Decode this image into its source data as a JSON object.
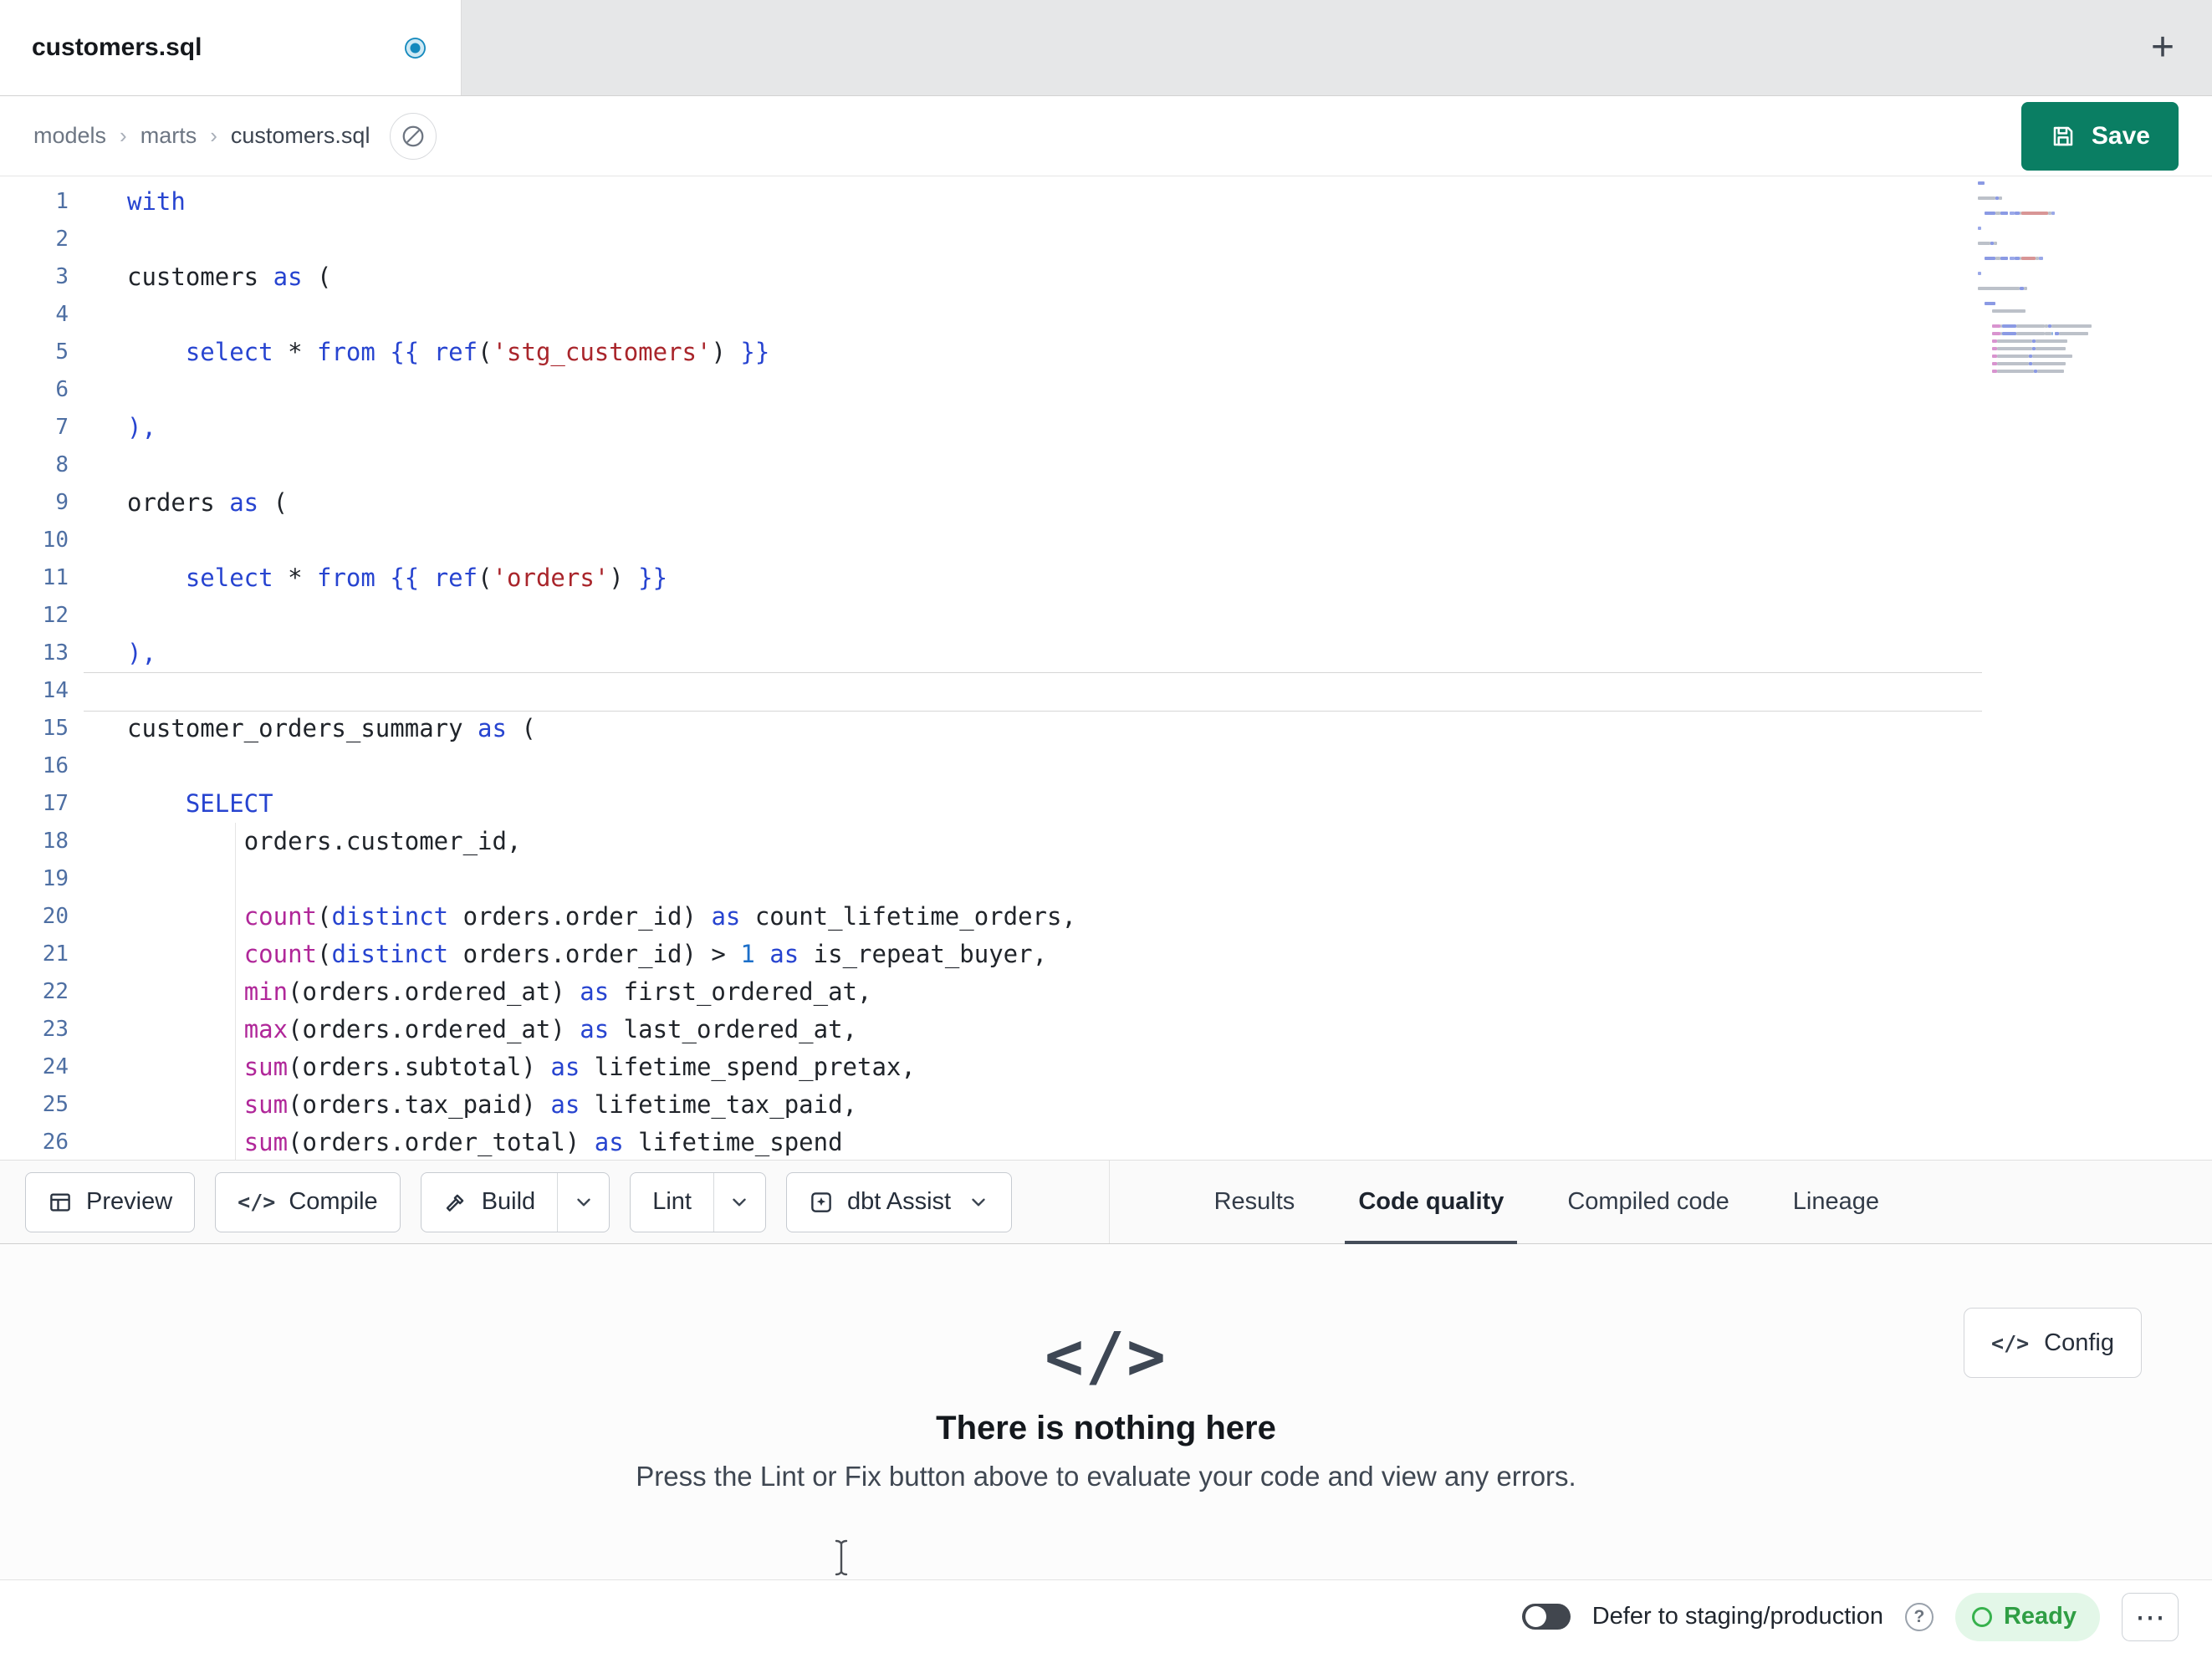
{
  "tabbar": {
    "tab_title": "customers.sql"
  },
  "breadcrumb": {
    "items": [
      "models",
      "marts",
      "customers.sql"
    ],
    "separator": "›"
  },
  "save_button": {
    "label": "Save"
  },
  "icons": {
    "plus": "+",
    "help": "?",
    "more": "⋯",
    "code_glyph": "</>"
  },
  "toolbar": {
    "preview": "Preview",
    "compile": "Compile",
    "build": "Build",
    "lint": "Lint",
    "assist": "dbt Assist"
  },
  "panel_tabs": [
    {
      "label": "Results",
      "active": false
    },
    {
      "label": "Code quality",
      "active": true
    },
    {
      "label": "Compiled code",
      "active": false
    },
    {
      "label": "Lineage",
      "active": false
    }
  ],
  "results_panel": {
    "empty_title": "There is nothing here",
    "empty_subtitle": "Press the Lint or Fix button above to evaluate your code and view any errors.",
    "config_label": "Config"
  },
  "statusbar": {
    "defer_label": "Defer to staging/production",
    "ready_label": "Ready"
  },
  "colors": {
    "save_accent": "#0a7e63",
    "ready_green": "#2f9e44",
    "keyword_blue": "#2744d0",
    "function_magenta": "#b02799",
    "string_red": "#a9252b",
    "modified_dot_blue": "#1489bd"
  },
  "editor": {
    "lines": [
      {
        "n": 1,
        "toks": [
          [
            "with",
            "kw"
          ]
        ]
      },
      {
        "n": 2,
        "toks": []
      },
      {
        "n": 3,
        "toks": [
          [
            "customers ",
            "txt"
          ],
          [
            "as",
            "kw"
          ],
          [
            " (",
            "txt"
          ]
        ]
      },
      {
        "n": 4,
        "toks": []
      },
      {
        "n": 5,
        "toks": [
          [
            "    ",
            "txt"
          ],
          [
            "select",
            "kw"
          ],
          [
            " * ",
            "txt"
          ],
          [
            "from",
            "kw"
          ],
          [
            " ",
            "txt"
          ],
          [
            "{{ ",
            "jin"
          ],
          [
            "ref",
            "kw"
          ],
          [
            "(",
            "txt"
          ],
          [
            "'stg_customers'",
            "str"
          ],
          [
            ") ",
            "txt"
          ],
          [
            "}}",
            "jin"
          ]
        ]
      },
      {
        "n": 6,
        "toks": []
      },
      {
        "n": 7,
        "toks": [
          [
            "),",
            "pun"
          ]
        ]
      },
      {
        "n": 8,
        "toks": []
      },
      {
        "n": 9,
        "toks": [
          [
            "orders ",
            "txt"
          ],
          [
            "as",
            "kw"
          ],
          [
            " (",
            "txt"
          ]
        ]
      },
      {
        "n": 10,
        "toks": []
      },
      {
        "n": 11,
        "toks": [
          [
            "    ",
            "txt"
          ],
          [
            "select",
            "kw"
          ],
          [
            " * ",
            "txt"
          ],
          [
            "from",
            "kw"
          ],
          [
            " ",
            "txt"
          ],
          [
            "{{ ",
            "jin"
          ],
          [
            "ref",
            "kw"
          ],
          [
            "(",
            "txt"
          ],
          [
            "'orders'",
            "str"
          ],
          [
            ") ",
            "txt"
          ],
          [
            "}}",
            "jin"
          ]
        ]
      },
      {
        "n": 12,
        "toks": []
      },
      {
        "n": 13,
        "toks": [
          [
            "),",
            "pun"
          ]
        ]
      },
      {
        "n": 14,
        "cursor": true,
        "toks": []
      },
      {
        "n": 15,
        "toks": [
          [
            "customer_orders_summary ",
            "txt"
          ],
          [
            "as",
            "kw"
          ],
          [
            " (",
            "txt"
          ]
        ]
      },
      {
        "n": 16,
        "toks": []
      },
      {
        "n": 17,
        "toks": [
          [
            "    ",
            "txt"
          ],
          [
            "SELECT",
            "kw"
          ]
        ]
      },
      {
        "n": 18,
        "toks": [
          [
            "        ",
            "txt"
          ],
          [
            "orders.customer_id,",
            "txt"
          ]
        ]
      },
      {
        "n": 19,
        "toks": []
      },
      {
        "n": 20,
        "toks": [
          [
            "        ",
            "txt"
          ],
          [
            "count",
            "fn"
          ],
          [
            "(",
            "txt"
          ],
          [
            "distinct",
            "kw"
          ],
          [
            " orders.order_id",
            "txt"
          ],
          [
            ") ",
            "txt"
          ],
          [
            "as",
            "kw"
          ],
          [
            " count_lifetime_orders,",
            "txt"
          ]
        ]
      },
      {
        "n": 21,
        "toks": [
          [
            "        ",
            "txt"
          ],
          [
            "count",
            "fn"
          ],
          [
            "(",
            "txt"
          ],
          [
            "distinct",
            "kw"
          ],
          [
            " orders.order_id",
            "txt"
          ],
          [
            ") > ",
            "txt"
          ],
          [
            "1",
            "num"
          ],
          [
            " ",
            "txt"
          ],
          [
            "as",
            "kw"
          ],
          [
            " is_repeat_buyer,",
            "txt"
          ]
        ]
      },
      {
        "n": 22,
        "toks": [
          [
            "        ",
            "txt"
          ],
          [
            "min",
            "fn"
          ],
          [
            "(orders.ordered_at) ",
            "txt"
          ],
          [
            "as",
            "kw"
          ],
          [
            " first_ordered_at,",
            "txt"
          ]
        ]
      },
      {
        "n": 23,
        "toks": [
          [
            "        ",
            "txt"
          ],
          [
            "max",
            "fn"
          ],
          [
            "(orders.ordered_at) ",
            "txt"
          ],
          [
            "as",
            "kw"
          ],
          [
            " last_ordered_at,",
            "txt"
          ]
        ]
      },
      {
        "n": 24,
        "toks": [
          [
            "        ",
            "txt"
          ],
          [
            "sum",
            "fn"
          ],
          [
            "(orders.subtotal) ",
            "txt"
          ],
          [
            "as",
            "kw"
          ],
          [
            " lifetime_spend_pretax,",
            "txt"
          ]
        ]
      },
      {
        "n": 25,
        "toks": [
          [
            "        ",
            "txt"
          ],
          [
            "sum",
            "fn"
          ],
          [
            "(orders.tax_paid) ",
            "txt"
          ],
          [
            "as",
            "kw"
          ],
          [
            " lifetime_tax_paid,",
            "txt"
          ]
        ]
      },
      {
        "n": 26,
        "toks": [
          [
            "        ",
            "txt"
          ],
          [
            "sum",
            "fn"
          ],
          [
            "(orders.order_total) ",
            "txt"
          ],
          [
            "as",
            "kw"
          ],
          [
            " lifetime_spend",
            "txt"
          ]
        ]
      }
    ]
  }
}
